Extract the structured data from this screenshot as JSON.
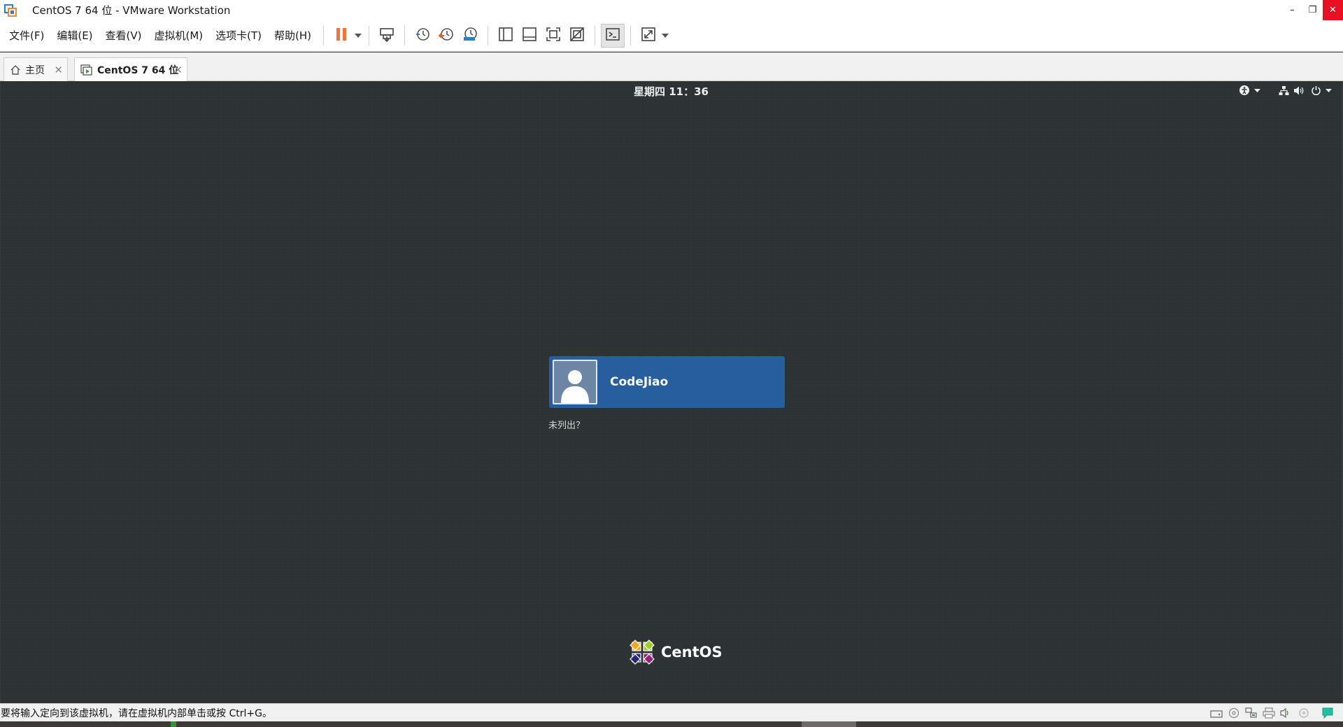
{
  "window": {
    "title": "CentOS 7 64 位 - VMware Workstation",
    "minimize": "–",
    "restore": "❐",
    "close": "✕"
  },
  "menu": [
    {
      "label": "文件(F)"
    },
    {
      "label": "编辑(E)"
    },
    {
      "label": "查看(V)"
    },
    {
      "label": "虚拟机(M)"
    },
    {
      "label": "选项卡(T)"
    },
    {
      "label": "帮助(H)"
    }
  ],
  "toolbar_icons": [
    "pause-icon",
    "send-ctrl-alt-del-icon",
    "snapshot-icon",
    "revert-snapshot-icon",
    "snapshot-manager-icon",
    "show-library-icon",
    "show-thumbnail-icon",
    "fullscreen-icon",
    "unity-icon",
    "console-view-icon",
    "stretch-guest-icon"
  ],
  "tabs": {
    "home": {
      "label": "主页",
      "close": "✕"
    },
    "vm": {
      "label": "CentOS 7 64 位",
      "close": "✕"
    }
  },
  "guest": {
    "clock": "星期四 11：36",
    "user_name": "CodeJiao",
    "not_listed": "未列出？",
    "logo_text": "CentOS"
  },
  "status": {
    "message": "要将输入定向到该虚拟机，请在虚拟机内部单击或按 Ctrl+G。"
  },
  "colors": {
    "accent": "#275f9e",
    "guest_bg": "#2c3133",
    "close_red": "#e81123",
    "pause_orange": "#f0743b"
  }
}
